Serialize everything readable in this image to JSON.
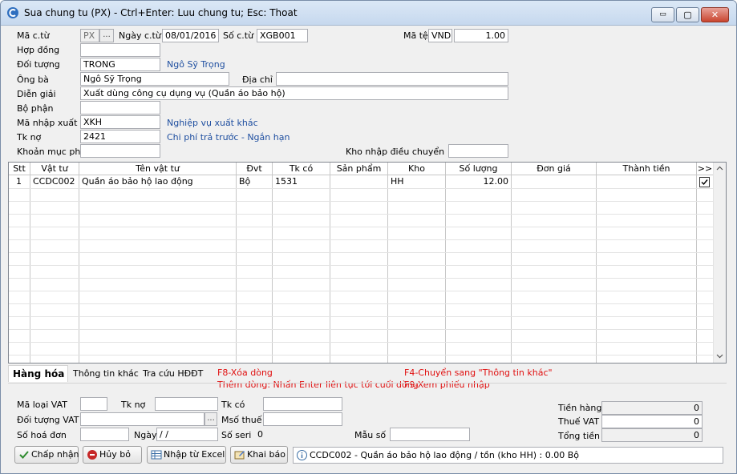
{
  "window": {
    "title": "Sua chung tu (PX) - Ctrl+Enter: Luu chung tu; Esc: Thoat",
    "min_glyph": "▭",
    "max_glyph": "▢",
    "close_glyph": "✕"
  },
  "header": {
    "ma_ct_label": "Mã c.từ",
    "ma_ct_value": "PX",
    "ma_ct_browse": "...",
    "ngay_ct_label": "Ngày c.từ",
    "ngay_ct_value": "08/01/2016",
    "so_ct_label": "Số c.từ",
    "so_ct_value": "XGB001",
    "ma_te_label": "Mã tệ",
    "ma_te_value": "VND",
    "ty_gia_value": "1.00",
    "hop_dong_label": "Hợp đồng",
    "hop_dong_value": "",
    "doi_tuong_label": "Đối tượng",
    "doi_tuong_value": "TRONG",
    "doi_tuong_name": "Ngô Sỹ Trọng",
    "ong_ba_label": "Ông bà",
    "ong_ba_value": "Ngô Sỹ Trọng",
    "dia_chi_label": "Địa chỉ",
    "dia_chi_value": "",
    "dien_giai_label": "Diễn giải",
    "dien_giai_value": "Xuất dùng công cụ dụng vụ (Quần áo bảo hộ)",
    "bo_phan_label": "Bộ phận",
    "bo_phan_value": "",
    "ma_nx_label": "Mã nhập xuất",
    "ma_nx_value": "XKH",
    "ma_nx_name": "Nghiệp vụ xuất khác",
    "tk_no_label": "Tk nợ",
    "tk_no_value": "2421",
    "tk_no_name": "Chi phí trả trước - Ngắn hạn",
    "khoan_muc_label": "Khoản mục phí",
    "khoan_muc_value": "",
    "kho_dc_label": "Kho nhập điều chuyển",
    "kho_dc_value": ""
  },
  "grid": {
    "columns": [
      "Stt",
      "Vật tư",
      "Tên vật tư",
      "Đvt",
      "Tk có",
      "Sản phẩm",
      "Kho",
      "Số lượng",
      "Đơn giá",
      "Thành tiền",
      ">>"
    ],
    "rows": [
      {
        "stt": "1",
        "vat_tu": "CCDC002",
        "ten": "Quần áo bảo hộ lao động",
        "dvt": "Bộ",
        "tk_co": "1531",
        "san_pham": "",
        "kho": "HH",
        "so_luong": "12.00",
        "don_gia": "",
        "thanh_tien": "",
        "checked": true
      }
    ]
  },
  "tabs": [
    "Hàng hóa",
    "Thông tin khác",
    "Tra cứu HĐĐT"
  ],
  "hints": {
    "f8": "F8-Xóa dòng",
    "them_dong": "Thêm dòng: Nhấn Enter liên tục tới cuối dòng",
    "f4": "F4-Chuyển sang \"Thông tin khác\"",
    "f9": "F9-Xem phiếu nhập"
  },
  "vat": {
    "ma_loai_label": "Mã loại VAT",
    "ma_loai_value": "",
    "tk_no_label": "Tk nợ",
    "tk_no_value": "",
    "tk_co_label": "Tk có",
    "tk_co_value": "",
    "doi_tuong_label": "Đối tượng VAT",
    "doi_tuong_value": "",
    "browse": "...",
    "mst_label": "Msố thuế",
    "mst_value": "",
    "so_hd_label": "Số hoá đơn",
    "so_hd_value": "",
    "ngay_label": "Ngày",
    "ngay_value": "/ /",
    "so_seri_label": "Số seri",
    "so_seri_value": "0",
    "mau_so_label": "Mẫu số",
    "mau_so_value": ""
  },
  "totals": {
    "tien_hang_label": "Tiền hàng",
    "tien_hang_value": "0",
    "thue_vat_label": "Thuế VAT",
    "thue_vat_value": "0",
    "tong_tien_label": "Tổng tiền",
    "tong_tien_value": "0"
  },
  "buttons": {
    "accept": "Chấp nhận",
    "cancel": "Hủy bỏ",
    "import_excel": "Nhập từ Excel",
    "declare": "Khai báo"
  },
  "status": "CCDC002 - Quần áo bảo hộ lao động / tồn (kho HH) : 0.00 Bộ",
  "colors": {
    "link": "#1f4fa0",
    "hint": "#e01010",
    "accept_icon": "#2e8b2e",
    "cancel_icon": "#c62828"
  }
}
